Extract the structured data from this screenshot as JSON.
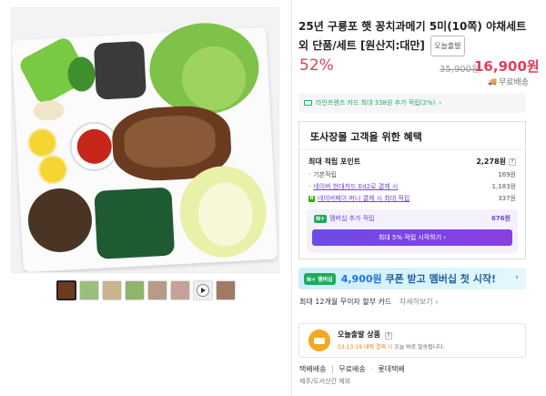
{
  "product": {
    "title": "25년 구룡포 햇 꽁치과메기 5미(10쪽) 야채세트 외 단품/세트 [원산지:대만]",
    "badge": "오늘출발",
    "discount": "52%",
    "original_price": "35,900원",
    "price": "16,900원",
    "shipping_label": "무료배송"
  },
  "card_banner": {
    "text": "라인프렌즈 카드 최대 338원 추가 적립(2%)",
    "arrow": "›"
  },
  "benefits": {
    "title": "또사장몰 고객을 위한 혜택",
    "max_points_label": "최대 적립 포인트",
    "max_points_value": "2,278원",
    "rows": [
      {
        "label": "기본적립",
        "value": "169원"
      },
      {
        "label": "네이버 현대카드 Ed2로 결제 시",
        "value": "1,183원"
      },
      {
        "label": "네이버페이 머니 결제 시 최대 적립",
        "value": "337원"
      }
    ],
    "member": {
      "badge": "N+",
      "label": "멤버십 추가 적립",
      "value": "676원",
      "button": "최대 5% 적립 시작하기 ›"
    }
  },
  "promo": {
    "logo": "N+ 멤버십",
    "amount": "4,900원",
    "text": "쿠폰 받고 멤버십 첫 시작!",
    "arrow": "›"
  },
  "installment": {
    "text": "최대 12개월 무이자 할부 카드",
    "more": "자세히보기 ›"
  },
  "today_shipping": {
    "title": "오늘출발 상품",
    "info_icon": "?",
    "sub_highlight": "03:13:19 내에 결제 시",
    "sub_text": " 오늘 바로 발송됩니다."
  },
  "delivery": {
    "type": "택배배송",
    "fee": "무료배송",
    "carrier": "롯데택배",
    "note": "제주/도서산간 제외"
  },
  "thumbnails": {
    "count": 8,
    "active_index": 0,
    "video_index": 6
  },
  "colors": {
    "accent_red": "#e23e57",
    "accent_purple": "#6f45d8",
    "naver_green": "#1eac5b"
  }
}
